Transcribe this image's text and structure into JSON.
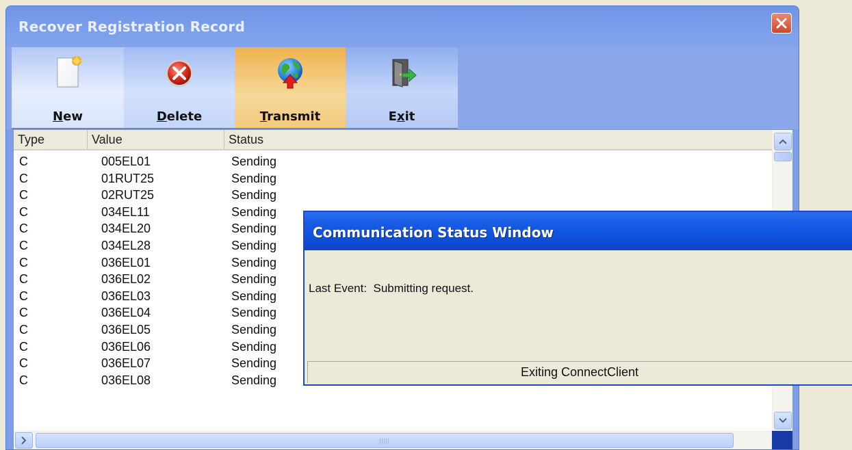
{
  "window": {
    "title": "Recover Registration Record"
  },
  "toolbar": {
    "new_label": "New",
    "delete_label": "Delete",
    "transmit_label": "Transmit",
    "exit_label": "Exit",
    "new_icon": "new-document-icon",
    "delete_icon": "delete-x-icon",
    "transmit_icon": "globe-transmit-icon",
    "exit_icon": "exit-door-icon"
  },
  "list": {
    "columns": [
      "Type",
      "Value",
      "Status"
    ],
    "rows": [
      {
        "type": "C",
        "value": "005EL01",
        "status": "Sending"
      },
      {
        "type": "C",
        "value": "01RUT25",
        "status": "Sending"
      },
      {
        "type": "C",
        "value": "02RUT25",
        "status": "Sending"
      },
      {
        "type": "C",
        "value": "034EL11",
        "status": "Sending"
      },
      {
        "type": "C",
        "value": "034EL20",
        "status": "Sending"
      },
      {
        "type": "C",
        "value": "034EL28",
        "status": "Sending"
      },
      {
        "type": "C",
        "value": "036EL01",
        "status": "Sending"
      },
      {
        "type": "C",
        "value": "036EL02",
        "status": "Sending"
      },
      {
        "type": "C",
        "value": "036EL03",
        "status": "Sending"
      },
      {
        "type": "C",
        "value": "036EL04",
        "status": "Sending"
      },
      {
        "type": "C",
        "value": "036EL05",
        "status": "Sending"
      },
      {
        "type": "C",
        "value": "036EL06",
        "status": "Sending"
      },
      {
        "type": "C",
        "value": "036EL07",
        "status": "Sending"
      },
      {
        "type": "C",
        "value": "036EL08",
        "status": "Sending"
      }
    ]
  },
  "comm_window": {
    "title": "Communication Status Window",
    "last_event": "Last Event:  Submitting request.",
    "status": "Exiting ConnectClient"
  },
  "colors": {
    "titlebar": "#7d9fea",
    "comm_titlebar": "#165ae3",
    "transmit_highlight": "#f7d89a"
  }
}
